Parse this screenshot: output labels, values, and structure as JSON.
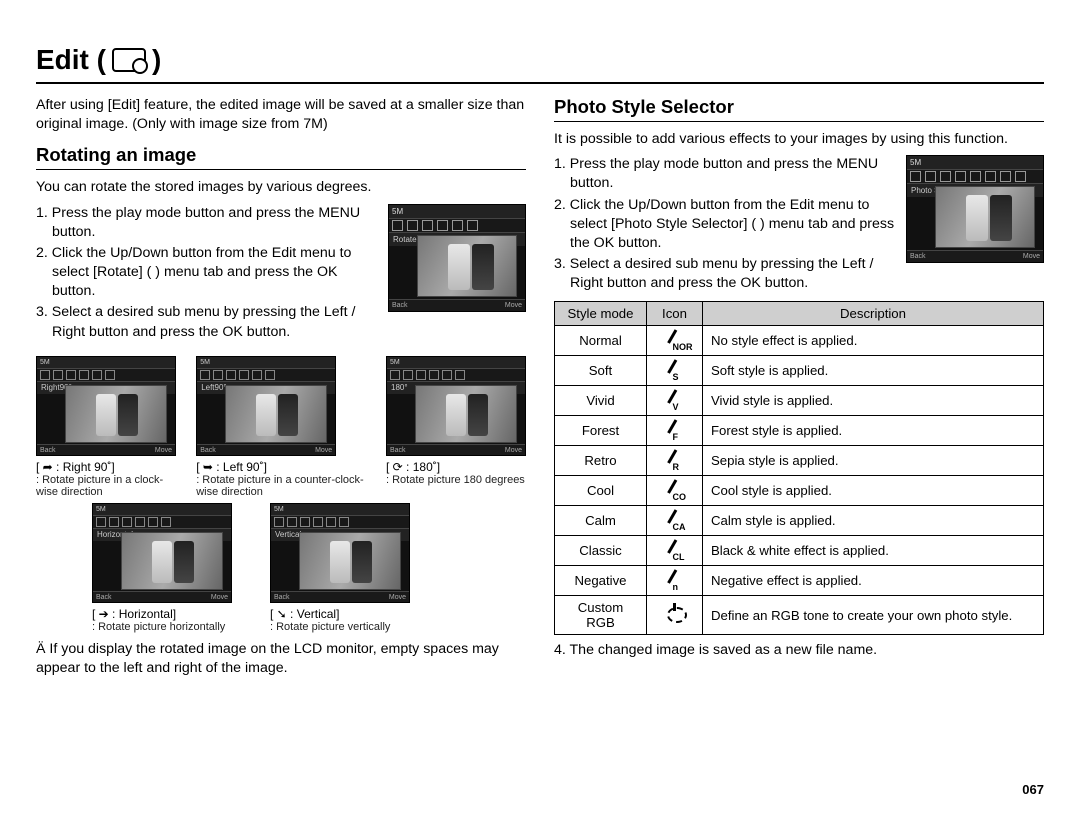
{
  "page": {
    "title_prefix": "Edit (",
    "title_suffix": " )",
    "number": "067"
  },
  "left": {
    "intro": "After using [Edit] feature, the edited image will be saved at a smaller size than original image. (Only with image size from 7M)",
    "section_title": "Rotating an image",
    "para": "You can rotate the stored images by various degrees.",
    "steps": [
      "1. Press the play mode button and press the MENU button.",
      "2. Click the Up/Down button from the Edit menu to select [Rotate] (       ) menu tab and press the OK button.",
      "3. Select a desired sub menu by pressing the Left / Right button and press the OK button."
    ],
    "lcd": {
      "top": "5M",
      "label": "Rotate",
      "back": "Back",
      "move": "Move"
    },
    "thumbs_row1": [
      {
        "label": "Right90°",
        "cap_title": "[  ➦  :  Right 90˚]",
        "cap_desc": ": Rotate picture in a clock-wise direction"
      },
      {
        "label": "Left90°",
        "cap_title": "[  ➥  :  Left 90˚]",
        "cap_desc": ": Rotate picture in a counter-clock-wise direction"
      },
      {
        "label": "180°",
        "cap_title": "[  ⟳  :   180˚]",
        "cap_desc": ": Rotate picture 180 degrees"
      }
    ],
    "thumbs_row2": [
      {
        "label": "Horizontal",
        "cap_title": "[  ➔ :   Horizontal]",
        "cap_desc": ": Rotate picture horizontally"
      },
      {
        "label": "Vertical",
        "cap_title": "[  ➘ :   Vertical]",
        "cap_desc": ": Rotate picture vertically"
      }
    ],
    "note": "Ä If you display the rotated image on the LCD monitor, empty spaces may appear to the left and right of the image."
  },
  "right": {
    "section_title": "Photo Style Selector",
    "intro": "It is possible to add various effects to your images by using this function.",
    "steps": [
      "1. Press the play mode button and press the MENU button.",
      "2. Click the Up/Down button from the Edit menu to select [Photo Style Selector] (         ) menu tab and press the OK button.",
      "3. Select a desired sub menu by pressing the Left / Right button and press the OK button."
    ],
    "lcd": {
      "top": "5M",
      "label": "Photo Style Selector",
      "back": "Back",
      "move": "Move"
    },
    "table": {
      "headers": [
        "Style mode",
        "Icon",
        "Description"
      ],
      "rows": [
        {
          "mode": "Normal",
          "sub": "NOR",
          "desc": "No style effect is applied."
        },
        {
          "mode": "Soft",
          "sub": "S",
          "desc": "Soft style is applied."
        },
        {
          "mode": "Vivid",
          "sub": "V",
          "desc": "Vivid style is applied."
        },
        {
          "mode": "Forest",
          "sub": "F",
          "desc": "Forest style is applied."
        },
        {
          "mode": "Retro",
          "sub": "R",
          "desc": "Sepia style is applied."
        },
        {
          "mode": "Cool",
          "sub": "CO",
          "desc": "Cool style is applied."
        },
        {
          "mode": "Calm",
          "sub": "CA",
          "desc": "Calm style is applied."
        },
        {
          "mode": "Classic",
          "sub": "CL",
          "desc": "Black & white effect is applied."
        },
        {
          "mode": "Negative",
          "sub": "n",
          "desc": "Negative effect is applied."
        },
        {
          "mode": "Custom RGB",
          "sub": "RGB",
          "desc": "Define an RGB tone to create your own photo style."
        }
      ]
    },
    "step4": "4. The changed image is saved as a new file name."
  }
}
